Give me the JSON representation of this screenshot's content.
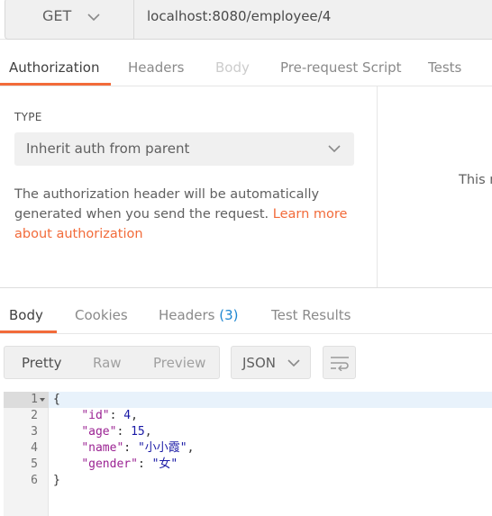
{
  "request": {
    "method": "GET",
    "url": "localhost:8080/employee/4"
  },
  "request_tabs": [
    {
      "label": "Authorization",
      "state": "active"
    },
    {
      "label": "Headers",
      "state": "normal"
    },
    {
      "label": "Body",
      "state": "disabled"
    },
    {
      "label": "Pre-request Script",
      "state": "normal"
    },
    {
      "label": "Tests",
      "state": "normal"
    }
  ],
  "auth": {
    "type_label": "TYPE",
    "type_value": "Inherit auth from parent",
    "description": "The authorization header will be automatically generated when you send the request.",
    "learn_more": "Learn more about authorization",
    "side_text": "This r"
  },
  "response_tabs": [
    {
      "label": "Body",
      "state": "active"
    },
    {
      "label": "Cookies",
      "state": "normal"
    },
    {
      "label": "Headers",
      "count": "(3)",
      "state": "normal"
    },
    {
      "label": "Test Results",
      "state": "normal"
    }
  ],
  "format": {
    "buttons": [
      "Pretty",
      "Raw",
      "Preview"
    ],
    "active": "Pretty",
    "language": "JSON"
  },
  "code": {
    "line_numbers": [
      "1",
      "2",
      "3",
      "4",
      "5",
      "6"
    ],
    "open_brace": "{",
    "close_brace": "}",
    "fields": [
      {
        "key": "\"id\"",
        "value": "4",
        "type": "number",
        "comma": ","
      },
      {
        "key": "\"age\"",
        "value": "15",
        "type": "number",
        "comma": ","
      },
      {
        "key": "\"name\"",
        "value": "\"小小霞\"",
        "type": "string",
        "comma": ","
      },
      {
        "key": "\"gender\"",
        "value": "\"女\"",
        "type": "string",
        "comma": ""
      }
    ]
  },
  "colors": {
    "accent": "#f26b3a",
    "link_blue": "#1f87d1",
    "json_key": "#9b2393",
    "json_value": "#1a1aa6"
  }
}
